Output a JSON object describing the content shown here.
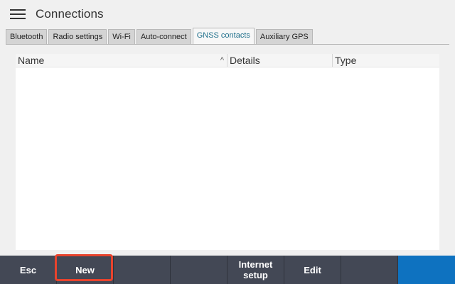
{
  "header": {
    "title": "Connections",
    "menu_icon": "hamburger-menu-icon"
  },
  "tabs": [
    {
      "label": "Bluetooth",
      "active": false
    },
    {
      "label": "Radio settings",
      "active": false
    },
    {
      "label": "Wi-Fi",
      "active": false
    },
    {
      "label": "Auto-connect",
      "active": false
    },
    {
      "label": "GNSS contacts",
      "active": true
    },
    {
      "label": "Auxiliary GPS",
      "active": false
    }
  ],
  "list": {
    "columns": [
      "Name",
      "Details",
      "Type"
    ],
    "sort_icon": "chevron-up-icon",
    "rows": []
  },
  "footer": {
    "buttons": [
      "Esc",
      "New",
      "",
      "",
      "Internet\nsetup",
      "Edit",
      "",
      ""
    ]
  },
  "colors": {
    "footer_bg": "#434855",
    "accent_blue": "#0e72c0",
    "highlight_red": "#e8432d",
    "active_tab_text": "#1f6f8b"
  }
}
